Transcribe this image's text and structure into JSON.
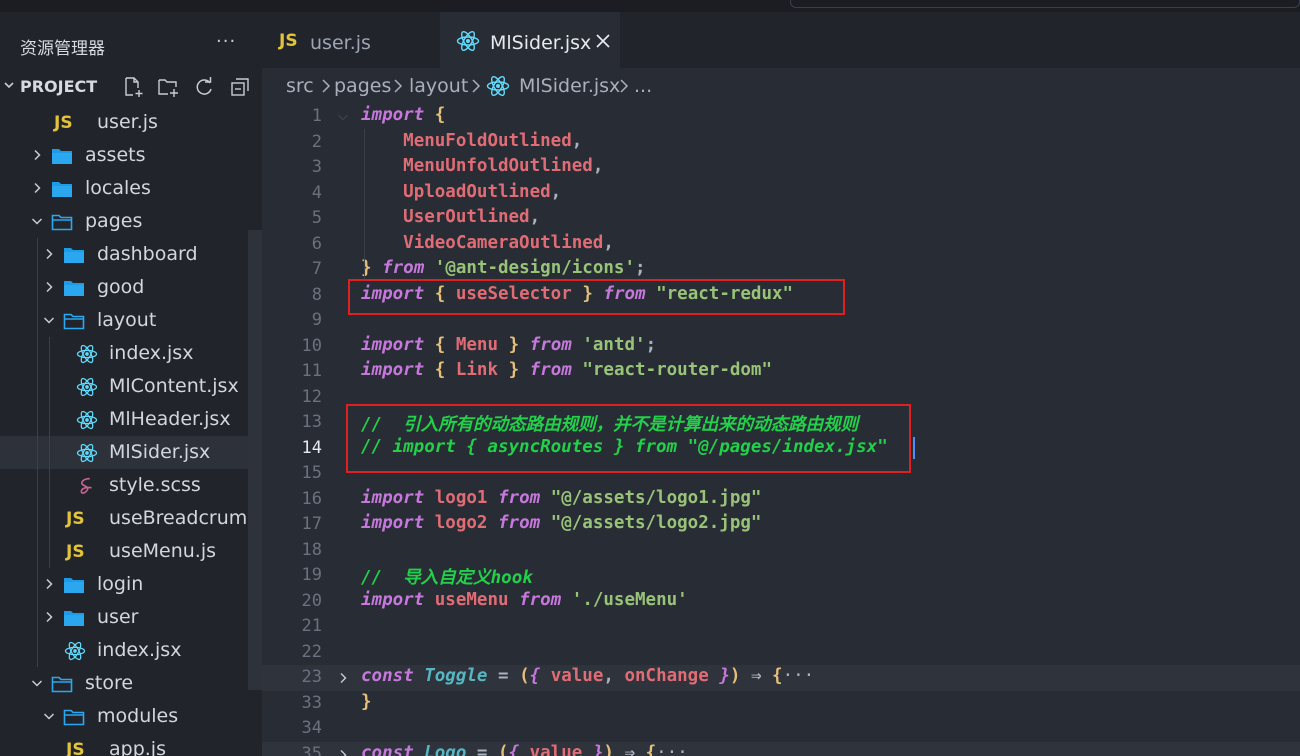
{
  "sidebar": {
    "title": "资源管理器",
    "more": "···",
    "project_label": "PROJECT",
    "actions": [
      "new-file",
      "new-folder",
      "refresh",
      "collapse-all"
    ]
  },
  "tree": [
    {
      "label": "user.js",
      "type": "js",
      "depth": 3
    },
    {
      "label": "assets",
      "type": "folder",
      "depth": 2,
      "expanded": false
    },
    {
      "label": "locales",
      "type": "folder",
      "depth": 2,
      "expanded": false
    },
    {
      "label": "pages",
      "type": "folder",
      "depth": 2,
      "expanded": true
    },
    {
      "label": "dashboard",
      "type": "folder",
      "depth": 3,
      "expanded": false
    },
    {
      "label": "good",
      "type": "folder",
      "depth": 3,
      "expanded": false
    },
    {
      "label": "layout",
      "type": "folder",
      "depth": 3,
      "expanded": true
    },
    {
      "label": "index.jsx",
      "type": "react",
      "depth": 4
    },
    {
      "label": "MlContent.jsx",
      "type": "react",
      "depth": 4
    },
    {
      "label": "MlHeader.jsx",
      "type": "react",
      "depth": 4
    },
    {
      "label": "MlSider.jsx",
      "type": "react",
      "depth": 4,
      "selected": true
    },
    {
      "label": "style.scss",
      "type": "sass",
      "depth": 4
    },
    {
      "label": "useBreadcrumb.js",
      "type": "js",
      "depth": 4
    },
    {
      "label": "useMenu.js",
      "type": "js",
      "depth": 4
    },
    {
      "label": "login",
      "type": "folder",
      "depth": 3,
      "expanded": false
    },
    {
      "label": "user",
      "type": "folder",
      "depth": 3,
      "expanded": false
    },
    {
      "label": "index.jsx",
      "type": "react",
      "depth": 3
    },
    {
      "label": "store",
      "type": "folder",
      "depth": 2,
      "expanded": true
    },
    {
      "label": "modules",
      "type": "folder",
      "depth": 3,
      "expanded": true
    },
    {
      "label": "app.js",
      "type": "js",
      "depth": 4
    }
  ],
  "tabs": [
    {
      "label": "user.js",
      "icon": "js-icon",
      "active": false
    },
    {
      "label": "MlSider.jsx",
      "icon": "react-icon",
      "active": true
    }
  ],
  "breadcrumb": {
    "parts": [
      "src",
      "pages",
      "layout",
      "MlSider.jsx",
      "..."
    ]
  },
  "editor": {
    "active_line": "14",
    "lines": [
      {
        "n": "1",
        "tokens": [
          [
            "kw",
            "import"
          ],
          [
            "pl",
            " "
          ],
          [
            "br",
            "{"
          ]
        ]
      },
      {
        "n": "2",
        "tokens": [
          [
            "pl",
            "    "
          ],
          [
            "id",
            "MenuFoldOutlined"
          ],
          [
            "pl",
            ","
          ]
        ]
      },
      {
        "n": "3",
        "tokens": [
          [
            "pl",
            "    "
          ],
          [
            "id",
            "MenuUnfoldOutlined"
          ],
          [
            "pl",
            ","
          ]
        ]
      },
      {
        "n": "4",
        "tokens": [
          [
            "pl",
            "    "
          ],
          [
            "id",
            "UploadOutlined"
          ],
          [
            "pl",
            ","
          ]
        ]
      },
      {
        "n": "5",
        "tokens": [
          [
            "pl",
            "    "
          ],
          [
            "id",
            "UserOutlined"
          ],
          [
            "pl",
            ","
          ]
        ]
      },
      {
        "n": "6",
        "tokens": [
          [
            "pl",
            "    "
          ],
          [
            "id",
            "VideoCameraOutlined"
          ],
          [
            "pl",
            ","
          ]
        ]
      },
      {
        "n": "7",
        "tokens": [
          [
            "br",
            "}"
          ],
          [
            "pl",
            " "
          ],
          [
            "kw",
            "from"
          ],
          [
            "pl",
            " "
          ],
          [
            "str",
            "'@ant-design/icons'"
          ],
          [
            "pl",
            ";"
          ]
        ]
      },
      {
        "n": "8",
        "tokens": [
          [
            "kw",
            "import"
          ],
          [
            "pl",
            " "
          ],
          [
            "br",
            "{"
          ],
          [
            "pl",
            " "
          ],
          [
            "id",
            "useSelector"
          ],
          [
            "pl",
            " "
          ],
          [
            "br",
            "}"
          ],
          [
            "pl",
            " "
          ],
          [
            "kw",
            "from"
          ],
          [
            "pl",
            " "
          ],
          [
            "str",
            "\"react-redux\""
          ]
        ]
      },
      {
        "n": "9",
        "tokens": []
      },
      {
        "n": "10",
        "tokens": [
          [
            "kw",
            "import"
          ],
          [
            "pl",
            " "
          ],
          [
            "br",
            "{"
          ],
          [
            "pl",
            " "
          ],
          [
            "id",
            "Menu"
          ],
          [
            "pl",
            " "
          ],
          [
            "br",
            "}"
          ],
          [
            "pl",
            " "
          ],
          [
            "kw",
            "from"
          ],
          [
            "pl",
            " "
          ],
          [
            "str",
            "'antd'"
          ],
          [
            "pl",
            ";"
          ]
        ]
      },
      {
        "n": "11",
        "tokens": [
          [
            "kw",
            "import"
          ],
          [
            "pl",
            " "
          ],
          [
            "br",
            "{"
          ],
          [
            "pl",
            " "
          ],
          [
            "id",
            "Link"
          ],
          [
            "pl",
            " "
          ],
          [
            "br",
            "}"
          ],
          [
            "pl",
            " "
          ],
          [
            "kw",
            "from"
          ],
          [
            "pl",
            " "
          ],
          [
            "str",
            "\"react-router-dom\""
          ]
        ]
      },
      {
        "n": "12",
        "tokens": []
      },
      {
        "n": "13",
        "tokens": [
          [
            "cmt",
            "//  引入所有的动态路由规则，并不是计算出来的动态路由规则"
          ]
        ]
      },
      {
        "n": "14",
        "tokens": [
          [
            "cmt",
            "// import { asyncRoutes } from \"@/pages/index.jsx\""
          ]
        ]
      },
      {
        "n": "15",
        "tokens": []
      },
      {
        "n": "16",
        "tokens": [
          [
            "kw",
            "import"
          ],
          [
            "pl",
            " "
          ],
          [
            "id",
            "logo1"
          ],
          [
            "pl",
            " "
          ],
          [
            "kw",
            "from"
          ],
          [
            "pl",
            " "
          ],
          [
            "str",
            "\"@/assets/logo1.jpg\""
          ]
        ]
      },
      {
        "n": "17",
        "tokens": [
          [
            "kw",
            "import"
          ],
          [
            "pl",
            " "
          ],
          [
            "id",
            "logo2"
          ],
          [
            "pl",
            " "
          ],
          [
            "kw",
            "from"
          ],
          [
            "pl",
            " "
          ],
          [
            "str",
            "\"@/assets/logo2.jpg\""
          ]
        ]
      },
      {
        "n": "18",
        "tokens": []
      },
      {
        "n": "19",
        "tokens": [
          [
            "cmt",
            "//  导入自定义hook"
          ]
        ]
      },
      {
        "n": "20",
        "tokens": [
          [
            "kw",
            "import"
          ],
          [
            "pl",
            " "
          ],
          [
            "id",
            "useMenu"
          ],
          [
            "pl",
            " "
          ],
          [
            "kw",
            "from"
          ],
          [
            "pl",
            " "
          ],
          [
            "str",
            "'./useMenu'"
          ]
        ]
      },
      {
        "n": "21",
        "tokens": []
      },
      {
        "n": "22",
        "tokens": []
      },
      {
        "n": "23",
        "folded": true,
        "tokens": [
          [
            "kw",
            "const"
          ],
          [
            "pl",
            " "
          ],
          [
            "fn",
            "Toggle"
          ],
          [
            "pl",
            " = "
          ],
          [
            "br",
            "("
          ],
          [
            "kw",
            "{"
          ],
          [
            "pl",
            " "
          ],
          [
            "id",
            "value"
          ],
          [
            "pl",
            ", "
          ],
          [
            "id",
            "onChange"
          ],
          [
            "pl",
            " "
          ],
          [
            "kw",
            "}"
          ],
          [
            "br",
            ")"
          ],
          [
            "pl",
            " ⇒ "
          ],
          [
            "br",
            "{"
          ],
          [
            "ellip",
            "···"
          ]
        ]
      },
      {
        "n": "33",
        "tokens": [
          [
            "br",
            "}"
          ]
        ]
      },
      {
        "n": "34",
        "tokens": []
      },
      {
        "n": "35",
        "folded": true,
        "tokens": [
          [
            "kw",
            "const"
          ],
          [
            "pl",
            " "
          ],
          [
            "fn",
            "Logo"
          ],
          [
            "pl",
            " = "
          ],
          [
            "br",
            "("
          ],
          [
            "kw",
            "{"
          ],
          [
            "pl",
            " "
          ],
          [
            "id",
            "value"
          ],
          [
            "pl",
            " "
          ],
          [
            "kw",
            "}"
          ],
          [
            "br",
            ")"
          ],
          [
            "pl",
            " ⇒ "
          ],
          [
            "br",
            "{"
          ],
          [
            "ellip",
            "···"
          ]
        ]
      }
    ]
  },
  "colors": {
    "background": "#282c34",
    "sidebar": "#21252b",
    "highlight_box": "#e02020",
    "keyword": "#c678dd",
    "string": "#98c379",
    "comment": "#22d04a"
  }
}
